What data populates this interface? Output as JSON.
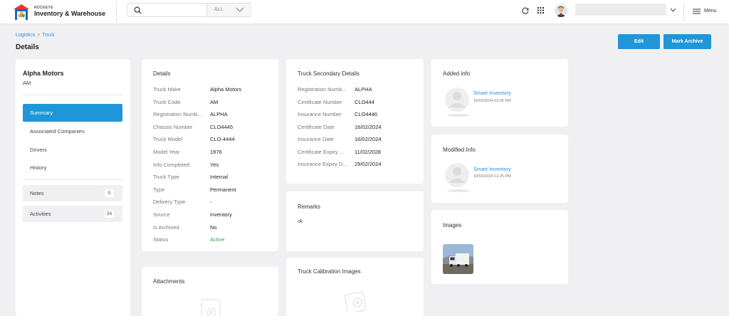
{
  "header": {
    "brand_small": "ROCKEYE",
    "brand_big": "Inventory & Warehouse",
    "search_placeholder": "",
    "search_filter": "ALL",
    "menu_label": "Menu"
  },
  "breadcrumb": {
    "items": [
      "Logistics",
      "Truck"
    ]
  },
  "page_title": "Details",
  "actions": {
    "edit": "Edit",
    "archive": "Mark Archive"
  },
  "sidebar": {
    "name": "Alpha Motors",
    "code": "AM",
    "items": [
      "Summary",
      "Associated Companies",
      "Drivers",
      "History"
    ],
    "notes": {
      "label": "Notes",
      "count": "0"
    },
    "activities": {
      "label": "Activities",
      "count": "24"
    }
  },
  "details": {
    "title": "Details",
    "rows": [
      {
        "k": "Truck Make",
        "v": "Alpha Motors"
      },
      {
        "k": "Truck Code",
        "v": "AM"
      },
      {
        "k": "Registration Numb...",
        "v": "ALPHA"
      },
      {
        "k": "Chassis Number",
        "v": "CLO4445"
      },
      {
        "k": "Truck Model",
        "v": "CLO-4444"
      },
      {
        "k": "Model Year",
        "v": "1976"
      },
      {
        "k": "Info Completed",
        "v": "Yes"
      },
      {
        "k": "Truck Type",
        "v": "Internal"
      },
      {
        "k": "Type",
        "v": "Permanent"
      },
      {
        "k": "Delivery Type",
        "v": "-"
      },
      {
        "k": "Source",
        "v": "Inventory"
      },
      {
        "k": "Is Archived",
        "v": "No"
      },
      {
        "k": "Status",
        "v": "Active"
      }
    ]
  },
  "secondary": {
    "title": "Truck Secondary Details",
    "rows": [
      {
        "k": "Registration Numb...",
        "v": "ALPHA"
      },
      {
        "k": "Certificate Number",
        "v": "CLO444"
      },
      {
        "k": "Insurance Number",
        "v": "CLO4446"
      },
      {
        "k": "Certificate Date",
        "v": "16/02/2024"
      },
      {
        "k": "Insurance Date",
        "v": "16/02/2024"
      },
      {
        "k": "Certificate Expiry ...",
        "v": "11/02/2028"
      },
      {
        "k": "Insurance Expiry D...",
        "v": "29/02/2024"
      }
    ]
  },
  "remarks": {
    "title": "Remarks",
    "text": "ok"
  },
  "attachments": {
    "title": "Attachments"
  },
  "calibration": {
    "title": "Truck Calibration Images"
  },
  "added_info": {
    "title": "Added info",
    "name": "Smart Inventory",
    "date": "16/02/2024 03:06 PM"
  },
  "modified_info": {
    "title": "Modified Info",
    "name": "Smart Inventory",
    "date": "19/02/2024 12:25 PM"
  },
  "images": {
    "title": "Images"
  },
  "colors": {
    "accent": "#1e96d9",
    "link": "#2a8fd8",
    "active": "#2aa44f",
    "background": "#f0f0f2"
  }
}
